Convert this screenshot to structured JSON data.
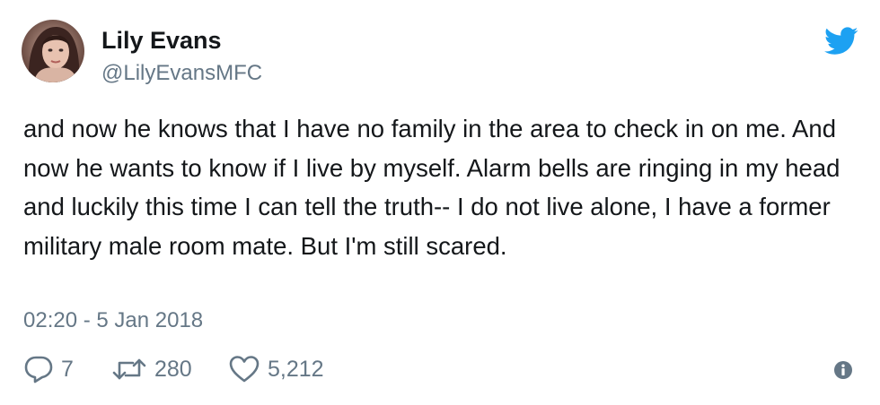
{
  "author": {
    "name": "Lily Evans",
    "handle": "@LilyEvansMFC"
  },
  "tweet": {
    "text": "and now he knows that I have no family in the area to check in on me. And now he wants to know if I live by myself. Alarm bells are ringing in my head and luckily this time I can tell the truth-- I do not live alone, I have a former military male room mate. But I'm still scared.",
    "timestamp": "02:20 - 5 Jan 2018"
  },
  "actions": {
    "reply_count": "7",
    "retweet_count": "280",
    "like_count": "5,212"
  },
  "icons": {
    "logo": "twitter-bird-icon",
    "reply": "reply-icon",
    "retweet": "retweet-icon",
    "like": "heart-icon",
    "info": "info-icon"
  },
  "colors": {
    "brand": "#1da1f2",
    "text": "#14171a",
    "secondary": "#657786"
  }
}
